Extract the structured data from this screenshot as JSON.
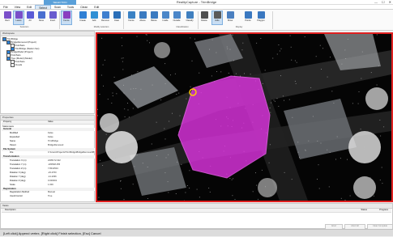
{
  "window": {
    "title": "RealityCapture - TrimBridge",
    "context_tab": "SELECTION",
    "minimize": "—",
    "maximize": "☐",
    "close": "✕"
  },
  "tabs": [
    "File",
    "View",
    "Edit",
    "Select",
    "Scan",
    "Tools",
    "Clean",
    "Edit"
  ],
  "ribbon": {
    "buttons": [
      {
        "label": "Rect",
        "color": "#7a4fc9"
      },
      {
        "label": "Lasso",
        "color": "#7a4fc9"
      },
      {
        "label": "All",
        "color": "#5b5bd6"
      },
      {
        "label": "None",
        "color": "#4a6fd0"
      },
      {
        "label": "Invert",
        "color": "#6a5ccf"
      },
      {
        "label": "Fence",
        "color": "#8a3fc0"
      },
      {
        "label": "Create",
        "color": "#2f7fd4"
      },
      {
        "label": "Add",
        "color": "#2f8fd4"
      },
      {
        "label": "Remove",
        "color": "#3f7fcf"
      },
      {
        "label": "Clear",
        "color": "#2a6fb8"
      },
      {
        "label": "Fence",
        "color": "#3b82c4"
      },
      {
        "label": "Above",
        "color": "#3a7ac0"
      },
      {
        "label": "Below",
        "color": "#3a7ac0"
      },
      {
        "label": "Inside",
        "color": "#4a86c8"
      },
      {
        "label": "Outside",
        "color": "#4a86c8"
      },
      {
        "label": "Classify",
        "color": "#3f7fbf"
      },
      {
        "label": "Delete",
        "color": "#4f4f4f"
      },
      {
        "label": "Hide",
        "color": "#5a5a5a"
      },
      {
        "label": "Show",
        "color": "#4a7fc0"
      },
      {
        "label": "Points",
        "color": "#3a78c0"
      },
      {
        "label": "Polygon",
        "color": "#3a78c0"
      }
    ],
    "groups": [
      "Selection",
      "Modify selection",
      "Classification",
      "Display"
    ]
  },
  "project_panel": {
    "title": "Workspace",
    "rows": [
      {
        "text": "TrimBridge",
        "indent": 0,
        "checked": true
      },
      {
        "text": "BridgeRemoved (Project)",
        "indent": 1,
        "checked": true
      },
      {
        "text": "PointSets",
        "indent": 2,
        "checked": false
      },
      {
        "text": "TrimBridge (Station Set)",
        "indent": 2,
        "checked": true
      },
      {
        "text": "BridgeModel (Project)",
        "indent": 1,
        "checked": true
      },
      {
        "text": "PointSets",
        "indent": 1,
        "checked": false
      },
      {
        "text": "Tree (Model) (Model)",
        "indent": 1,
        "checked": true
      },
      {
        "text": "PointSets",
        "indent": 2,
        "checked": false
      },
      {
        "text": "Clouds",
        "indent": 2,
        "checked": false
      }
    ]
  },
  "properties_panel": {
    "title": "Properties",
    "col_property": "Property",
    "col_value": "Value",
    "object": "Stationsets",
    "rows": [
      {
        "k": "General",
        "v": "",
        "sec": true
      },
      {
        "k": "Modified",
        "v": "False",
        "sec": false
      },
      {
        "k": "Expanded",
        "v": "False",
        "sec": false
      },
      {
        "k": "Name",
        "v": "TrimBridge",
        "sec": false
      },
      {
        "k": "Parent",
        "v": "BridgeRemoved",
        "sec": false
      },
      {
        "k": "File System",
        "v": "",
        "sec": true
      },
      {
        "k": "File",
        "v": "C:\\Users\\Projects\\TrimBridge\\BridgeRemoved\\Bridge...",
        "sec": false
      },
      {
        "k": "Transformation",
        "v": "",
        "sec": true
      },
      {
        "k": "Translation X (m)",
        "v": "2405172.022",
        "sec": false
      },
      {
        "k": "Translation Y (m)",
        "v": "-183548.455",
        "sec": false
      },
      {
        "k": "Translation Z (m)",
        "v": "7.8014504",
        "sec": false
      },
      {
        "k": "Rotation X (deg)",
        "v": "-23.4700",
        "sec": false
      },
      {
        "k": "Rotation Y (deg)",
        "v": "-14.4296",
        "sec": false
      },
      {
        "k": "Rotation Z (deg)",
        "v": "0.000001",
        "sec": false
      },
      {
        "k": "Scale",
        "v": "1.000",
        "sec": false
      },
      {
        "k": "Registration",
        "v": "",
        "sec": true
      },
      {
        "k": "Registration Method",
        "v": "Manual",
        "sec": false
      },
      {
        "k": "UseInControl",
        "v": "True",
        "sec": false
      }
    ]
  },
  "tasks_panel": {
    "title": "Tasks",
    "col_description": "Description",
    "col_status": "Status",
    "col_progress": "Progress",
    "buttons": [
      "Abort",
      "Abort All",
      "Clear Complete"
    ]
  },
  "status": "[Left click] Append vertex, [Right click] Finish selection, [Esc] Cancel",
  "viewport": {
    "selection_color": "#e535e8",
    "border_color": "#e02020",
    "background": "#050505"
  }
}
